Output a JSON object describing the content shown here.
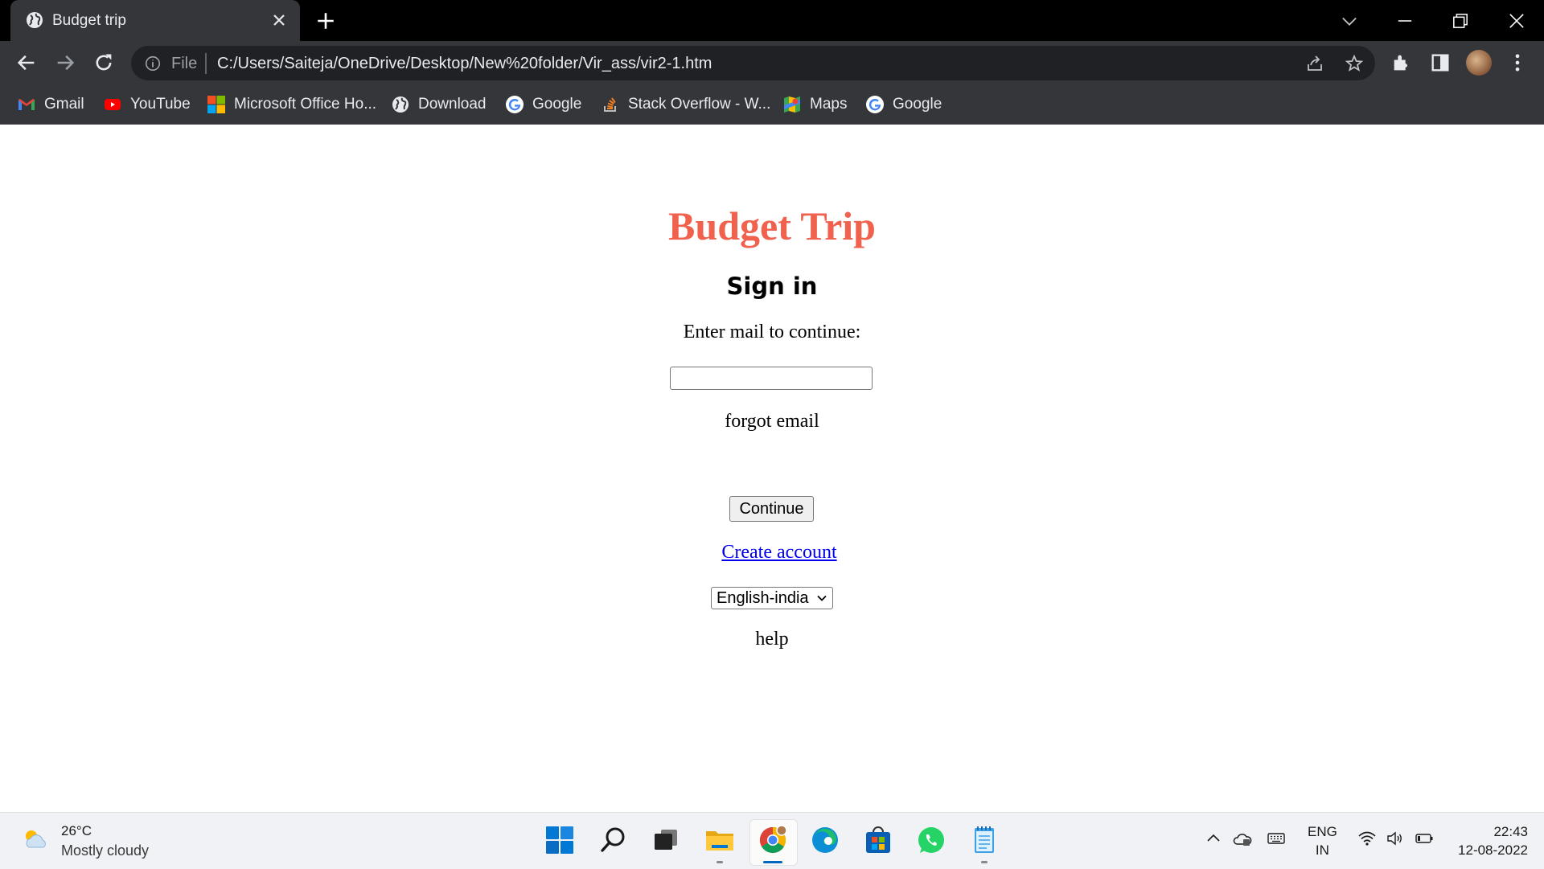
{
  "browser": {
    "tab_title": "Budget trip",
    "omnibox_scheme": "File",
    "url": "C:/Users/Saiteja/OneDrive/Desktop/New%20folder/Vir_ass/vir2-1.htm"
  },
  "bookmarks": [
    {
      "label": "Gmail",
      "icon": "gmail-icon"
    },
    {
      "label": "YouTube",
      "icon": "youtube-icon"
    },
    {
      "label": "Microsoft Office Ho...",
      "icon": "microsoft-icon"
    },
    {
      "label": "Download",
      "icon": "globe-icon"
    },
    {
      "label": "Google",
      "icon": "google-icon"
    },
    {
      "label": "Stack Overflow - W...",
      "icon": "stackoverflow-icon"
    },
    {
      "label": "Maps",
      "icon": "maps-icon"
    },
    {
      "label": "Google",
      "icon": "google-icon"
    }
  ],
  "page": {
    "heading": "Budget Trip",
    "subheading": "Sign in",
    "prompt": "Enter mail to continue:",
    "email_value": "",
    "forgot_email": "forgot email",
    "continue_label": "Continue",
    "create_account": "Create account",
    "language_selected": "English-india",
    "help": "help",
    "accent_color": "#f0624d",
    "link_color": "#0000ee"
  },
  "taskbar": {
    "temperature": "26°C",
    "condition": "Mostly cloudy",
    "apps": [
      "start-icon",
      "search-icon",
      "task-view-icon",
      "file-explorer-icon",
      "chrome-icon",
      "edge-icon",
      "store-icon",
      "whatsapp-icon",
      "notepad-icon"
    ],
    "language_line1": "ENG",
    "language_line2": "IN",
    "time": "22:43",
    "date": "12-08-2022"
  }
}
